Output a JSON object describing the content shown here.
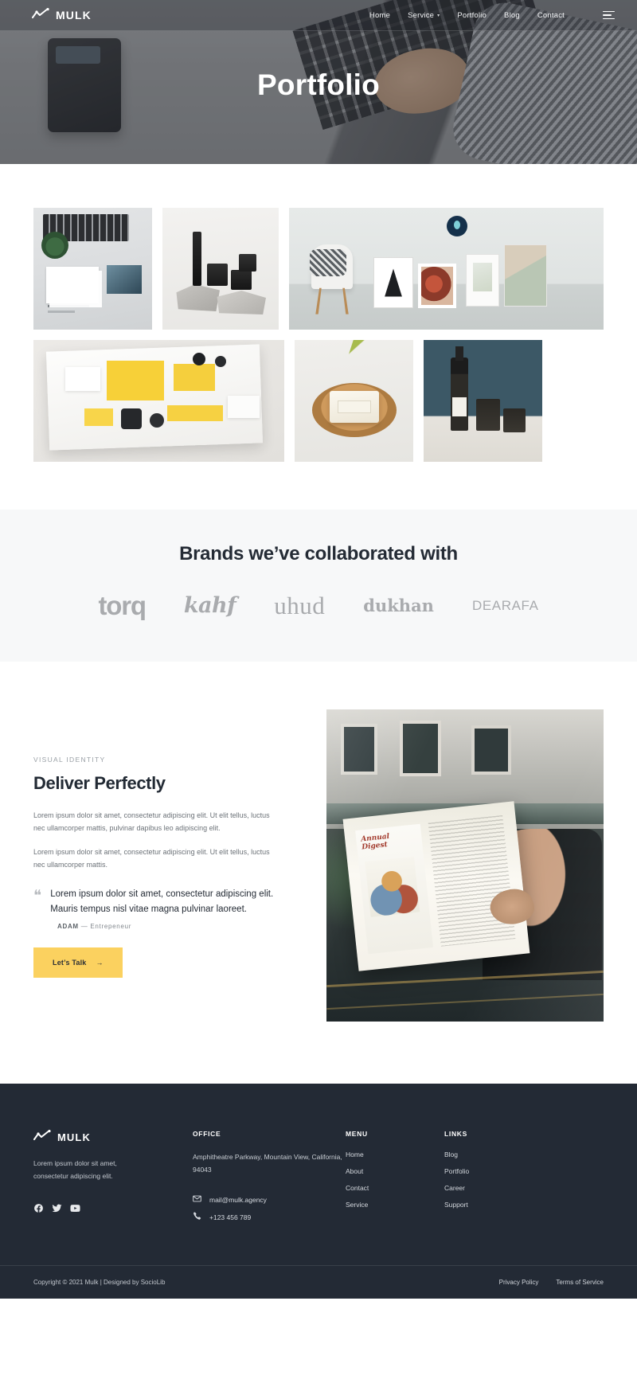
{
  "nav": {
    "brand": "MULK",
    "brand_icon": "chart-line-icon",
    "links": [
      {
        "label": "Home"
      },
      {
        "label": "Service",
        "has_caret": true
      },
      {
        "label": "Portfolio"
      },
      {
        "label": "Blog"
      },
      {
        "label": "Contact"
      }
    ],
    "menu_icon": "hamburger-icon"
  },
  "hero": {
    "title": "Portfolio"
  },
  "portfolio": {
    "items": [
      {
        "alt": "branding stationery on desk with laptop and plant"
      },
      {
        "alt": "black cosmetic jars and tube on stone slabs"
      },
      {
        "alt": "gallery wall with framed prints and white chair"
      },
      {
        "alt": "open magazine with yellow stationery set"
      },
      {
        "alt": "handmade soap on wooden plate with leaves"
      },
      {
        "alt": "oil bottle and cosmetic jars on teal background"
      }
    ]
  },
  "brands": {
    "heading": "Brands we’ve collaborated with",
    "logos": [
      {
        "name": "torq"
      },
      {
        "name": "kahf"
      },
      {
        "name": "uhud"
      },
      {
        "name": "dukhan"
      },
      {
        "name": "DEARAFA"
      }
    ]
  },
  "feature": {
    "eyebrow": "VISUAL IDENTITY",
    "title": "Deliver Perfectly",
    "paragraph1": "Lorem ipsum dolor sit amet, consectetur adipiscing elit. Ut elit tellus, luctus nec ullamcorper mattis, pulvinar dapibus leo adipiscing elit.",
    "paragraph2": "Lorem ipsum dolor sit amet, consectetur adipiscing elit. Ut elit tellus, luctus nec ullamcorper mattis.",
    "quote_mark": "❝",
    "quote": "Lorem ipsum dolor sit amet, consectetur adipiscing elit. Mauris tempus nisl vitae magna pulvinar laoreet.",
    "author_name": "ADAM",
    "author_dash": "—",
    "author_role": "Entrepeneur",
    "cta_label": "Let’s Talk",
    "cta_arrow": "→",
    "cta_color": "#fbd15f",
    "image_alt": "man reading Annual Digest magazine seen through cafe window"
  },
  "footer": {
    "brand": "MULK",
    "brand_icon": "chart-line-icon",
    "description": "Lorem ipsum dolor sit amet, consectetur adipiscing elit.",
    "socials": [
      {
        "name": "facebook-icon"
      },
      {
        "name": "twitter-icon"
      },
      {
        "name": "youtube-icon"
      }
    ],
    "office": {
      "heading": "OFFICE",
      "address": "Amphitheatre Parkway, Mountain View, California, 94043",
      "email": "mail@mulk.agency",
      "email_icon": "envelope-icon",
      "phone": "+123 456 789",
      "phone_icon": "phone-icon"
    },
    "menu": {
      "heading": "MENU",
      "items": [
        {
          "label": "Home"
        },
        {
          "label": "About"
        },
        {
          "label": "Contact"
        },
        {
          "label": "Service"
        }
      ]
    },
    "links": {
      "heading": "LINKS",
      "items": [
        {
          "label": "Blog"
        },
        {
          "label": "Portfolio"
        },
        {
          "label": "Career"
        },
        {
          "label": "Support"
        }
      ]
    },
    "bottom": {
      "copyright": "Copyright © 2021 Mulk | Designed by SocioLib",
      "legal": [
        {
          "label": "Privacy Policy"
        },
        {
          "label": "Terms of Service"
        }
      ]
    }
  },
  "theme": {
    "accent": "#fbd15f",
    "dark": "#232a35",
    "body_text": "#6c7278",
    "brands_bg": "#f7f8f9"
  }
}
